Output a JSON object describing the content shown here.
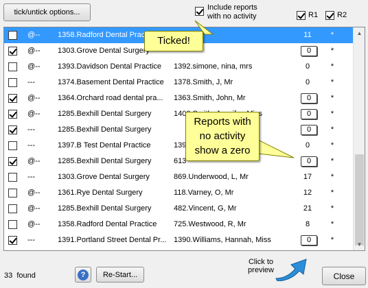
{
  "toolbar": {
    "tick_untick_label": "tick/untick options...",
    "include_label": "Include reports\nwith no activity",
    "include_checked": true,
    "r1_label": "R1",
    "r1_checked": true,
    "r2_label": "R2",
    "r2_checked": true
  },
  "rows": [
    {
      "checked": false,
      "at": "@--",
      "practice": "1358.Radford Dental Practice",
      "name": "",
      "r1": "11",
      "r1_boxed": false,
      "r2": "*",
      "selected": true
    },
    {
      "checked": true,
      "at": "@--",
      "practice": "1303.Grove Dental Surgery",
      "name": "",
      "r1": "0",
      "r1_boxed": true,
      "r2": "*",
      "selected": false
    },
    {
      "checked": false,
      "at": "@--",
      "practice": "1393.Davidson Dental Practice",
      "name": "1392.simone, nina, mrs",
      "r1": "0",
      "r1_boxed": false,
      "r2": "*",
      "selected": false
    },
    {
      "checked": false,
      "at": "---",
      "practice": "1374.Basement Dental Practice",
      "name": "1378.Smith, J, Mr",
      "r1": "0",
      "r1_boxed": false,
      "r2": "*",
      "selected": false
    },
    {
      "checked": true,
      "at": "@--",
      "practice": "1364.Orchard road dental pra...",
      "name": "1363.Smith, John, Mr",
      "r1": "0",
      "r1_boxed": true,
      "r2": "*",
      "selected": false
    },
    {
      "checked": true,
      "at": "@--",
      "practice": "1285.Bexhill Dental Surgery",
      "name": "1400.Smith, Jennifer, Miss",
      "r1": "0",
      "r1_boxed": true,
      "r2": "*",
      "selected": false
    },
    {
      "checked": true,
      "at": "---",
      "practice": "1285.Bexhill Dental Surgery",
      "name": "",
      "r1": "0",
      "r1_boxed": true,
      "r2": "*",
      "selected": false
    },
    {
      "checked": false,
      "at": "---",
      "practice": "1397.B Test Dental Practice",
      "name": "139",
      "r1": "0",
      "r1_boxed": false,
      "r2": "*",
      "selected": false
    },
    {
      "checked": true,
      "at": "@--",
      "practice": "1285.Bexhill Dental Surgery",
      "name": "613",
      "r1": "0",
      "r1_boxed": true,
      "r2": "*",
      "selected": false
    },
    {
      "checked": false,
      "at": "---",
      "practice": "1303.Grove Dental Surgery",
      "name": "869.Underwood, L, Mr",
      "r1": "17",
      "r1_boxed": false,
      "r2": "*",
      "selected": false
    },
    {
      "checked": false,
      "at": "@--",
      "practice": "1361.Rye Dental Surgery",
      "name": "118.Varney, O, Mr",
      "r1": "12",
      "r1_boxed": false,
      "r2": "*",
      "selected": false
    },
    {
      "checked": false,
      "at": "@--",
      "practice": "1285.Bexhill Dental Surgery",
      "name": "482.Vincent, G, Mr",
      "r1": "21",
      "r1_boxed": false,
      "r2": "*",
      "selected": false
    },
    {
      "checked": false,
      "at": "@--",
      "practice": "1358.Radford Dental Practice",
      "name": "725.Westwood, R, Mr",
      "r1": "8",
      "r1_boxed": false,
      "r2": "*",
      "selected": false
    },
    {
      "checked": true,
      "at": "---",
      "practice": "1391.Portland Street Dental Pr...",
      "name": "1390.Williams, Hannah, Miss",
      "r1": "0",
      "r1_boxed": true,
      "r2": "*",
      "selected": false
    }
  ],
  "status": {
    "found_text": "33  found"
  },
  "footer": {
    "help_icon": "question-icon",
    "restart_label": "Re-Start...",
    "preview_hint": "Click to\npreview",
    "close_label": "Close"
  },
  "callouts": {
    "ticked": "Ticked!",
    "reports": "Reports with\nno activity\nshow a zero"
  },
  "colors": {
    "selection": "#3399ff",
    "callout": "#ffff99",
    "arrow": "#2a8fd8"
  }
}
